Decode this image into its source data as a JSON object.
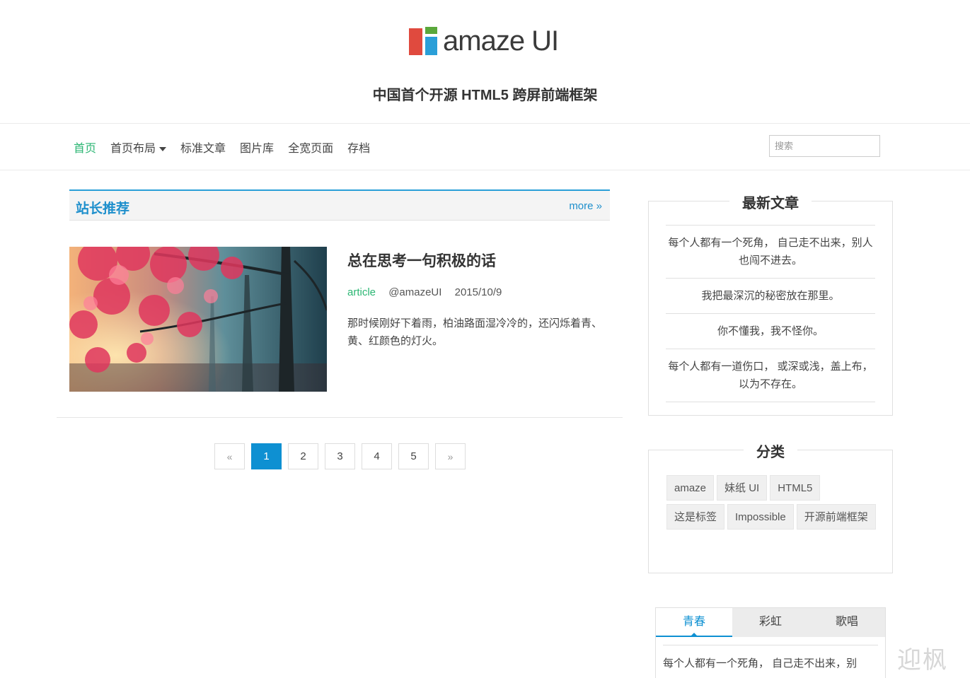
{
  "header": {
    "logo_text": "amaze UI",
    "tagline": "中国首个开源 HTML5 跨屏前端框架"
  },
  "nav": {
    "items": [
      "首页",
      "首页布局",
      "标准文章",
      "图片库",
      "全宽页面",
      "存档"
    ],
    "active_index": 0,
    "dropdown_index": 1,
    "search_placeholder": "搜索"
  },
  "recommend": {
    "title": "站长推荐",
    "more": "more »"
  },
  "article": {
    "title": "总在思考一句积极的话",
    "category": "article",
    "author": "@amazeUI",
    "date": "2015/10/9",
    "excerpt": "那时候刚好下着雨，柏油路面湿冷冷的，还闪烁着青、黄、红颜色的灯火。"
  },
  "pagination": {
    "prev": "«",
    "pages": [
      "1",
      "2",
      "3",
      "4",
      "5"
    ],
    "next": "»",
    "current": "1"
  },
  "sidebar": {
    "latest": {
      "title": "最新文章",
      "posts": [
        "每个人都有一个死角， 自己走不出来，别人也闯不进去。",
        "我把最深沉的秘密放在那里。",
        "你不懂我，我不怪你。",
        "每个人都有一道伤口， 或深或浅，盖上布，以为不存在。"
      ]
    },
    "categories": {
      "title": "分类",
      "tags": [
        "amaze",
        "妹纸 UI",
        "HTML5",
        "这是标签",
        "Impossible",
        "开源前端框架"
      ]
    },
    "tabs": {
      "labels": [
        "青春",
        "彩虹",
        "歌唱"
      ],
      "active_index": 0,
      "content": "每个人都有一个死角， 自己走不出来，别"
    }
  },
  "colors": {
    "accent_blue": "#0e90d2",
    "accent_green": "#2bb673"
  },
  "watermark": "迎枫"
}
